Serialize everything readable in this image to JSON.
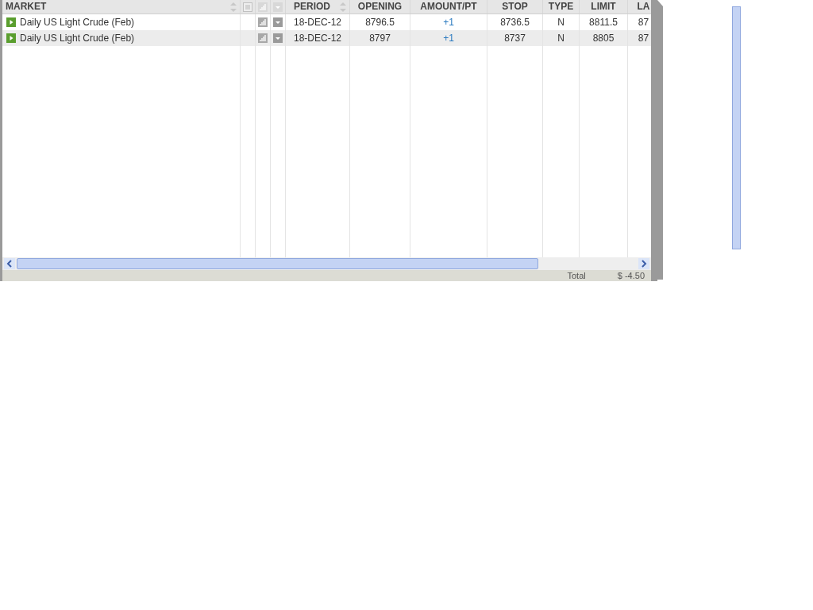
{
  "table": {
    "columns": [
      "MARKET",
      "PERIOD",
      "OPENING",
      "AMOUNT/PT",
      "STOP",
      "TYPE",
      "LIMIT",
      "LA"
    ],
    "rows": [
      {
        "market": "Daily US Light Crude (Feb)",
        "period": "18-DEC-12",
        "opening": "8796.5",
        "amount": "+1",
        "stop": "8736.5",
        "type": "N",
        "limit": "8811.5",
        "column_8": "87"
      },
      {
        "market": "Daily US Light Crude (Feb)",
        "period": "18-DEC-12",
        "opening": "8797",
        "amount": "+1",
        "stop": "8737",
        "type": "N",
        "limit": "8805",
        "column_8": "87"
      }
    ]
  },
  "footer": {
    "label": "Total",
    "value": "$ -4.50"
  }
}
